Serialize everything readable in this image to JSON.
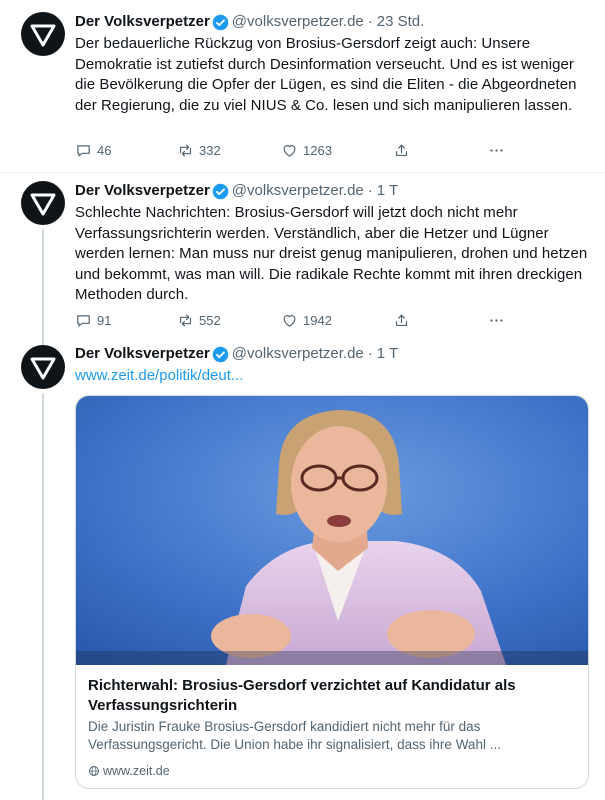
{
  "tweets": [
    {
      "name": "Der Volksverpetzer",
      "handle": "@volksverpetzer.de",
      "time": "23 Std.",
      "text": "Der bedauerliche Rückzug von Brosius-Gersdorf zeigt auch: Unsere Demokratie ist zutiefst durch Desinformation verseucht. Und es ist weniger die Bevölkerung die Opfer der Lügen, es sind die Eliten - die Abgeordneten der Regierung, die zu viel NIUS & Co. lesen und sich manipulieren lassen.",
      "replies": "46",
      "reposts": "332",
      "likes": "1263"
    },
    {
      "name": "Der Volksverpetzer",
      "handle": "@volksverpetzer.de",
      "time": "1 T",
      "text": "Schlechte Nachrichten: Brosius-Gersdorf will jetzt doch nicht mehr Verfassungsrichterin werden. Verständlich, aber die Hetzer und Lügner werden lernen: Man muss nur dreist genug manipulieren, drohen und hetzen und bekommt, was man will. Die radikale Rechte kommt mit ihren dreckigen Methoden durch.",
      "replies": "91",
      "reposts": "552",
      "likes": "1942"
    },
    {
      "name": "Der Volksverpetzer",
      "handle": "@volksverpetzer.de",
      "time": "1 T",
      "link": "www.zeit.de/politik/deut...",
      "card": {
        "title": "Richterwahl: Brosius-Gersdorf verzichtet auf Kandidatur als Verfassungsrichterin",
        "description": "Die Juristin Frauke Brosius-Gersdorf kandidiert nicht mehr für das Verfassungsgericht. Die Union habe ihr signalisiert, dass ihre Wahl ...",
        "domain": "www.zeit.de"
      }
    }
  ],
  "icons": {
    "verified": "verified-badge-icon",
    "reply": "reply-icon",
    "repost": "repost-icon",
    "like": "heart-icon",
    "share": "share-icon",
    "more": "more-icon",
    "globe": "globe-icon"
  },
  "colors": {
    "accent": "#1d9bf0",
    "text": "#0f1419",
    "muted": "#536471",
    "border": "#cfd9de"
  }
}
